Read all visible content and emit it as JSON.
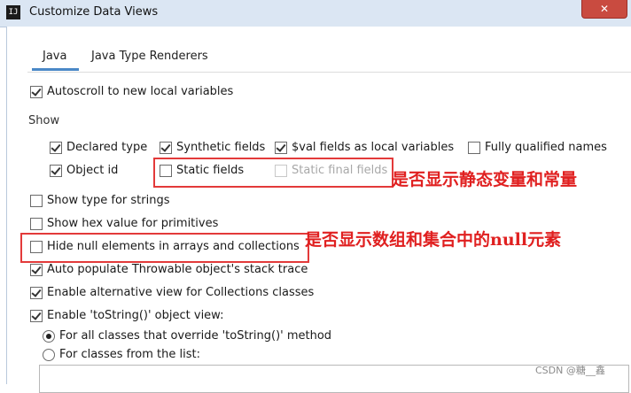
{
  "window": {
    "title": "Customize Data Views",
    "icon_text": "IJ",
    "close_label": "✕"
  },
  "tabs": [
    {
      "label": "Java",
      "active": true
    },
    {
      "label": "Java Type Renderers",
      "active": false
    }
  ],
  "options": {
    "autoscroll": {
      "label": "Autoscroll to new local variables",
      "checked": true
    },
    "show_section_label": "Show",
    "declared_type": {
      "label": "Declared type",
      "checked": true
    },
    "synthetic_fields": {
      "label": "Synthetic fields",
      "checked": true
    },
    "val_fields": {
      "label": "$val fields as local variables",
      "checked": true
    },
    "fully_qualified": {
      "label": "Fully qualified names",
      "checked": false
    },
    "object_id": {
      "label": "Object id",
      "checked": true
    },
    "static_fields": {
      "label": "Static fields",
      "checked": false
    },
    "static_final_fields": {
      "label": "Static final fields",
      "checked": false,
      "disabled": true
    },
    "show_type_strings": {
      "label": "Show type for strings",
      "checked": false
    },
    "show_hex": {
      "label": "Show hex value for primitives",
      "checked": false
    },
    "hide_null": {
      "label": "Hide null elements in arrays and collections",
      "checked": false
    },
    "auto_populate": {
      "label": "Auto populate Throwable object's stack trace",
      "checked": true
    },
    "alt_view": {
      "label": "Enable alternative view for Collections classes",
      "checked": true
    },
    "tostring_view": {
      "label": "Enable 'toString()' object view:",
      "checked": true
    },
    "radio_all": {
      "label": "For all classes that override 'toString()' method",
      "selected": true
    },
    "radio_list": {
      "label": "For classes from the list:",
      "selected": false
    }
  },
  "annotations": {
    "static": "是否显示静态变量和常量",
    "null": "是否显示数组和集合中的null元素"
  },
  "watermark": "CSDN @糖__鑫",
  "colors": {
    "highlight": "#e33a3a",
    "annotation": "#e02020",
    "tab_underline": "#4a88c7"
  }
}
